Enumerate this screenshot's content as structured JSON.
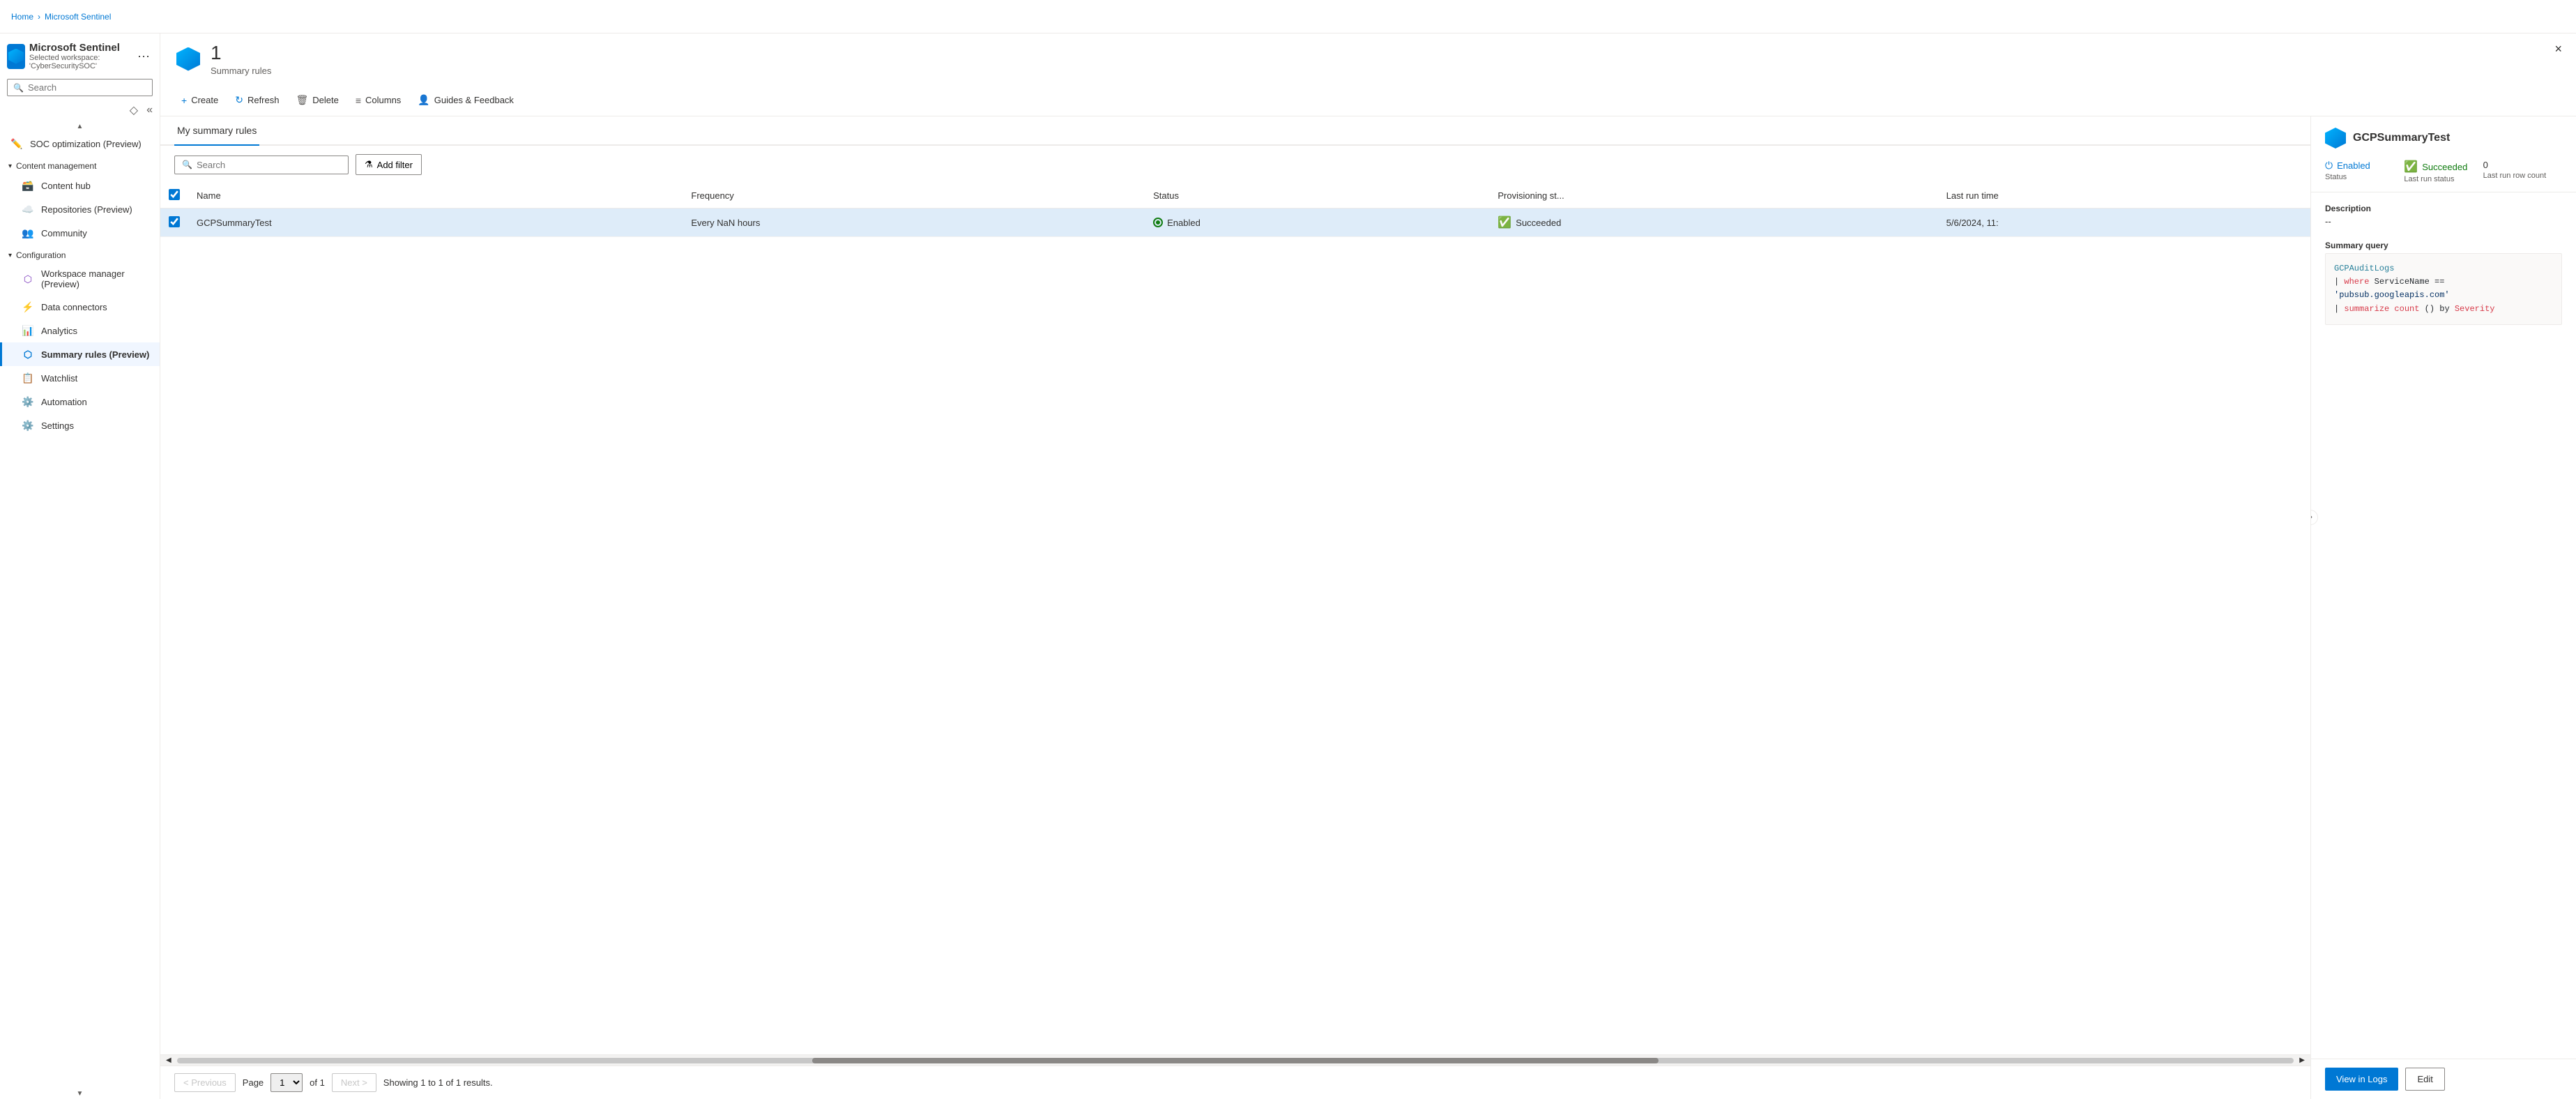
{
  "breadcrumb": {
    "home": "Home",
    "sentinel": "Microsoft Sentinel",
    "separator": "›"
  },
  "header": {
    "title": "Microsoft Sentinel | Summary rules (Preview)",
    "subtitle": "Selected workspace: 'CyberSecuritySOC'",
    "ellipsis": "···",
    "close": "×"
  },
  "sidebar": {
    "search_placeholder": "Search",
    "items": [
      {
        "id": "soc-optimization",
        "label": "SOC optimization (Preview)",
        "icon": "✏️",
        "indent": false
      },
      {
        "id": "content-management",
        "label": "Content management",
        "icon": "▾",
        "group": true
      },
      {
        "id": "content-hub",
        "label": "Content hub",
        "icon": "🗃️",
        "indent": true
      },
      {
        "id": "repositories",
        "label": "Repositories (Preview)",
        "icon": "☁️",
        "indent": true
      },
      {
        "id": "community",
        "label": "Community",
        "icon": "👥",
        "indent": true
      },
      {
        "id": "configuration",
        "label": "Configuration",
        "icon": "▾",
        "group": true
      },
      {
        "id": "workspace-manager",
        "label": "Workspace manager (Preview)",
        "icon": "🔷",
        "indent": true
      },
      {
        "id": "data-connectors",
        "label": "Data connectors",
        "icon": "⚡",
        "indent": true
      },
      {
        "id": "analytics",
        "label": "Analytics",
        "icon": "📊",
        "indent": true
      },
      {
        "id": "summary-rules",
        "label": "Summary rules (Preview)",
        "icon": "🔷",
        "indent": true,
        "active": true
      },
      {
        "id": "watchlist",
        "label": "Watchlist",
        "icon": "📋",
        "indent": true
      },
      {
        "id": "automation",
        "label": "Automation",
        "icon": "⚙️",
        "indent": true
      },
      {
        "id": "settings",
        "label": "Settings",
        "icon": "⚙️",
        "indent": true
      }
    ]
  },
  "toolbar": {
    "create_label": "Create",
    "refresh_label": "Refresh",
    "delete_label": "Delete",
    "columns_label": "Columns",
    "guides_label": "Guides & Feedback"
  },
  "summary_count": {
    "count": "1",
    "label": "Summary rules"
  },
  "tabs": {
    "my_rules": "My summary rules"
  },
  "table": {
    "search_placeholder": "Search",
    "add_filter_label": "Add filter",
    "columns": [
      "Name",
      "Frequency",
      "Status",
      "Provisioning st...",
      "Last run time"
    ],
    "rows": [
      {
        "name": "GCPSummaryTest",
        "frequency": "Every NaN hours",
        "status": "Enabled",
        "provisioning": "Succeeded",
        "last_run": "5/6/2024, 11:"
      }
    ]
  },
  "pagination": {
    "prev_label": "< Previous",
    "next_label": "Next >",
    "page_label": "Page",
    "of_label": "of 1",
    "page_value": "1",
    "results_label": "Showing 1 to 1 of 1 results."
  },
  "detail": {
    "title": "GCPSummaryTest",
    "status_label": "Status",
    "status_value": "Enabled",
    "last_run_status_label": "Last run status",
    "last_run_status_value": "Succeeded",
    "last_run_row_count_label": "Last run row count",
    "last_run_row_count_value": "0",
    "description_label": "Description",
    "description_value": "--",
    "summary_query_label": "Summary query",
    "code_line1": "GCPAuditLogs",
    "code_line2": "| where ServiceName == 'pubsub.googleapis.com'",
    "code_line3": "| summarize count() by Severity",
    "view_logs_label": "View in Logs",
    "edit_label": "Edit"
  }
}
